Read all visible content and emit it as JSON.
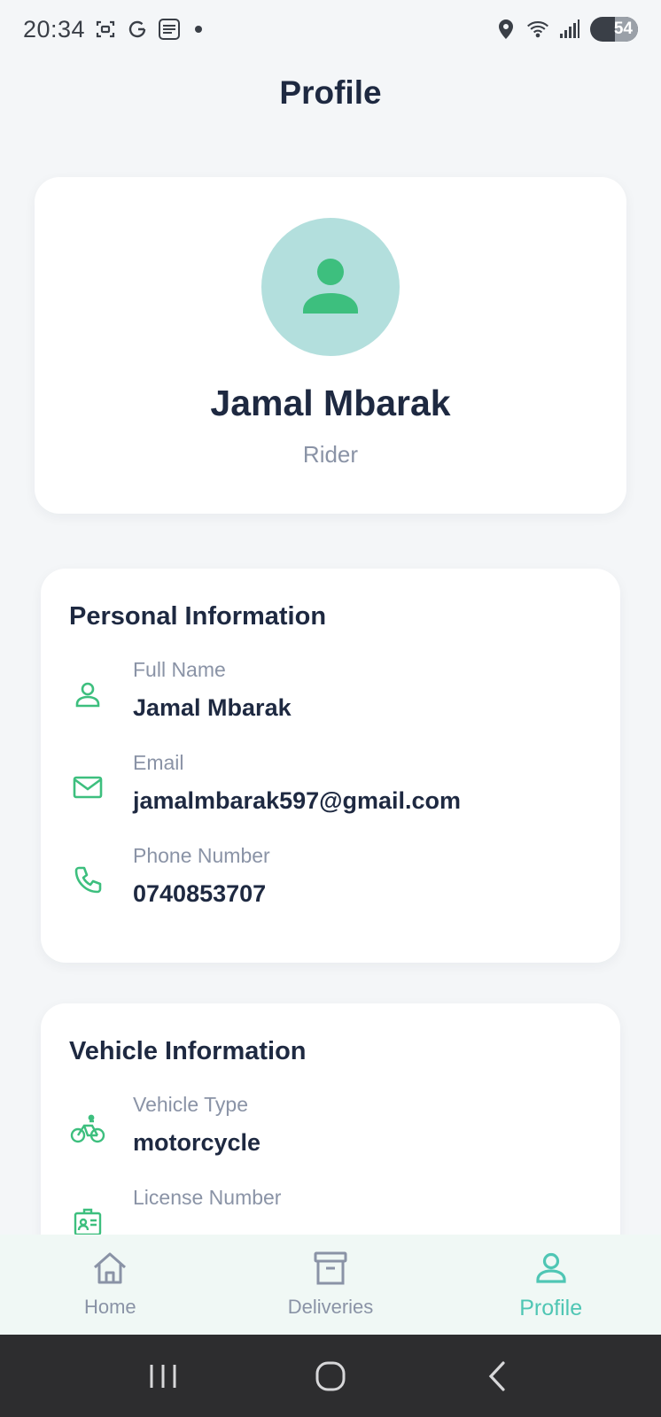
{
  "status_bar": {
    "time": "20:34",
    "battery": "54",
    "icons": [
      "screenshot-icon",
      "g-icon",
      "touch-n-go-icon",
      "dot-icon",
      "location-icon",
      "wifi-icon",
      "signal-icon",
      "battery-icon"
    ]
  },
  "page": {
    "title": "Profile"
  },
  "profile": {
    "name": "Jamal Mbarak",
    "role": "Rider",
    "avatar_icon": "person-icon"
  },
  "personal_info": {
    "title": "Personal Information",
    "rows": [
      {
        "label": "Full Name",
        "value": "Jamal Mbarak",
        "icon": "person-outline-icon"
      },
      {
        "label": "Email",
        "value": "jamalmbarak597@gmail.com",
        "icon": "mail-icon"
      },
      {
        "label": "Phone Number",
        "value": "0740853707",
        "icon": "phone-icon"
      }
    ]
  },
  "vehicle_info": {
    "title": "Vehicle Information",
    "rows": [
      {
        "label": "Vehicle Type",
        "value": "motorcycle",
        "icon": "bicycle-icon"
      },
      {
        "label": "License Number",
        "value": "",
        "icon": "id-card-icon"
      }
    ]
  },
  "bottom_nav": {
    "items": [
      {
        "label": "Home",
        "icon": "home-icon",
        "active": false
      },
      {
        "label": "Deliveries",
        "icon": "archive-box-icon",
        "active": false
      },
      {
        "label": "Profile",
        "icon": "person-outline-icon",
        "active": true
      }
    ]
  },
  "system_nav": {
    "buttons": [
      "recent-apps-icon",
      "home-circle-icon",
      "back-icon"
    ]
  },
  "colors": {
    "accent": "#3dbf7e",
    "avatar_bg": "#b3dfdd",
    "active_nav": "#4fc6b4",
    "text_primary": "#1e2941",
    "text_secondary": "#8a93a6",
    "background": "#f4f6f8"
  }
}
